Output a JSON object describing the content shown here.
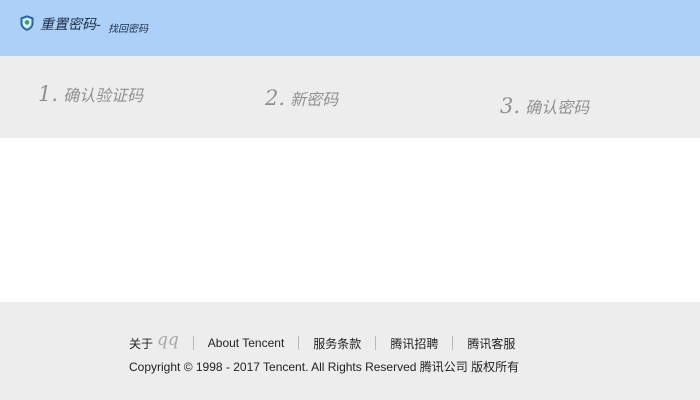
{
  "header": {
    "title": "重置密码-",
    "subtitle": "找回密码",
    "logo_icon": "shield-icon",
    "background": "#acd0f7"
  },
  "steps": [
    {
      "number": "1.",
      "label": "确认验证码"
    },
    {
      "number": "2.",
      "label": "新密码"
    },
    {
      "number": "3.",
      "label": "确认密码"
    }
  ],
  "footer": {
    "about_label": "关于",
    "qq_label": "qq",
    "links": [
      "About Tencent",
      "服务条款",
      "腾讯招聘",
      "腾讯客服"
    ],
    "copyright": "Copyright © 1998 - 2017 Tencent. All Rights Reserved 腾讯公司 版权所有",
    "background": "#ededed"
  }
}
